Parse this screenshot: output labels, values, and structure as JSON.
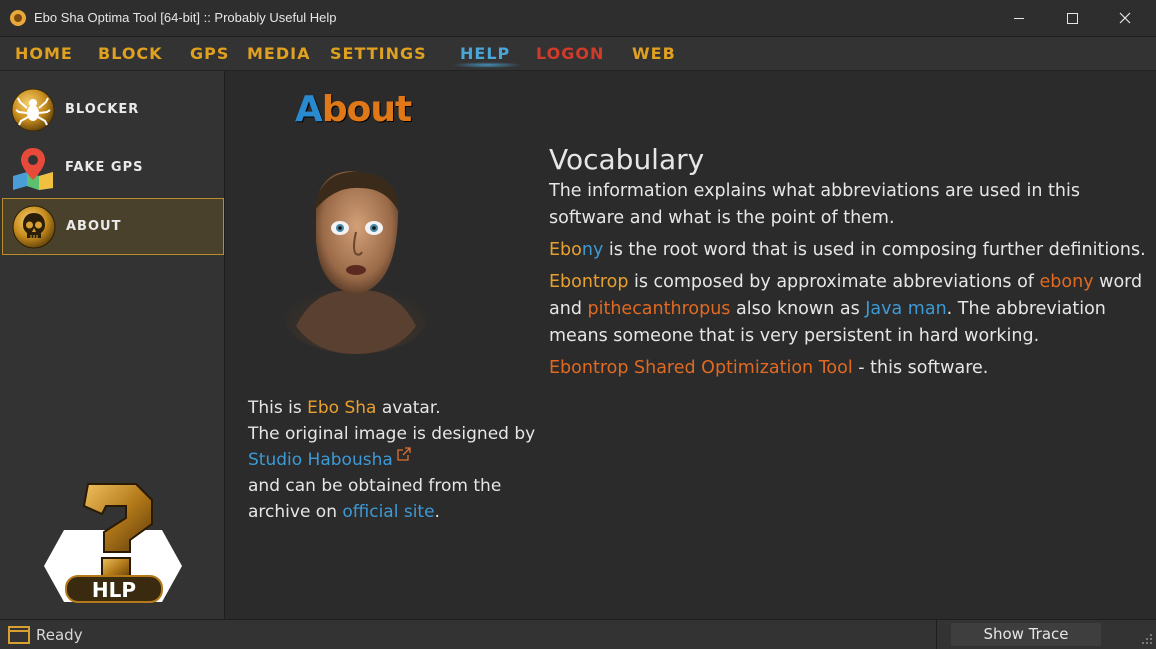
{
  "window": {
    "title": "Ebo Sha Optima Tool [64-bit] :: Probably Useful Help"
  },
  "menu": {
    "items": [
      {
        "label": "HOME"
      },
      {
        "label": "BLOCK"
      },
      {
        "label": "GPS"
      },
      {
        "label": "MEDIA"
      },
      {
        "label": "SETTINGS"
      },
      {
        "label": "HELP"
      },
      {
        "label": "LOGON"
      },
      {
        "label": "WEB"
      }
    ],
    "active": "HELP"
  },
  "sidebar": {
    "items": [
      {
        "label": "BLOCKER",
        "icon": "spider-icon"
      },
      {
        "label": "FAKE GPS",
        "icon": "map-pin-icon"
      },
      {
        "label": "ABOUT",
        "icon": "skull-icon"
      }
    ],
    "active": "ABOUT",
    "logo_text": "HLP"
  },
  "about": {
    "heading_first": "A",
    "heading_rest": "bout",
    "avatar_caption": {
      "line1_pre": "This is ",
      "line1_name": "Ebo Sha",
      "line1_post": " avatar.",
      "line2": "The original image is designed by",
      "designer_link": "Studio Habousha",
      "line4": "and can be obtained from the",
      "line5_pre": "archive on ",
      "site_link": "official site",
      "line5_post": "."
    }
  },
  "vocabulary": {
    "title": "Vocabulary",
    "intro": "The information explains what abbreviations are used in this software and what is the point of them.",
    "p2_ebo": "Ebo",
    "p2_ny": "ny",
    "p2_rest": " is the root word that is used in composing further definitions.",
    "p3_term": "Ebontrop",
    "p3_a": " is composed by approximate abbreviations of ",
    "p3_ebony": "ebony",
    "p3_b": " word and ",
    "p3_pithe": "pithecanthropus",
    "p3_c": " also known as ",
    "p3_java": "Java man",
    "p3_d": ". The abbreviation means someone that is very persistent in hard working.",
    "p4_term": "Ebontrop Shared Optimization Tool",
    "p4_rest": " - this software."
  },
  "status": {
    "text": "Ready",
    "trace_button": "Show Trace"
  },
  "colors": {
    "accent_gold": "#e0a020",
    "accent_blue": "#4aa6d8",
    "accent_red": "#d23a2a",
    "link_orange": "#e06a22",
    "background": "#2b2b2b"
  }
}
